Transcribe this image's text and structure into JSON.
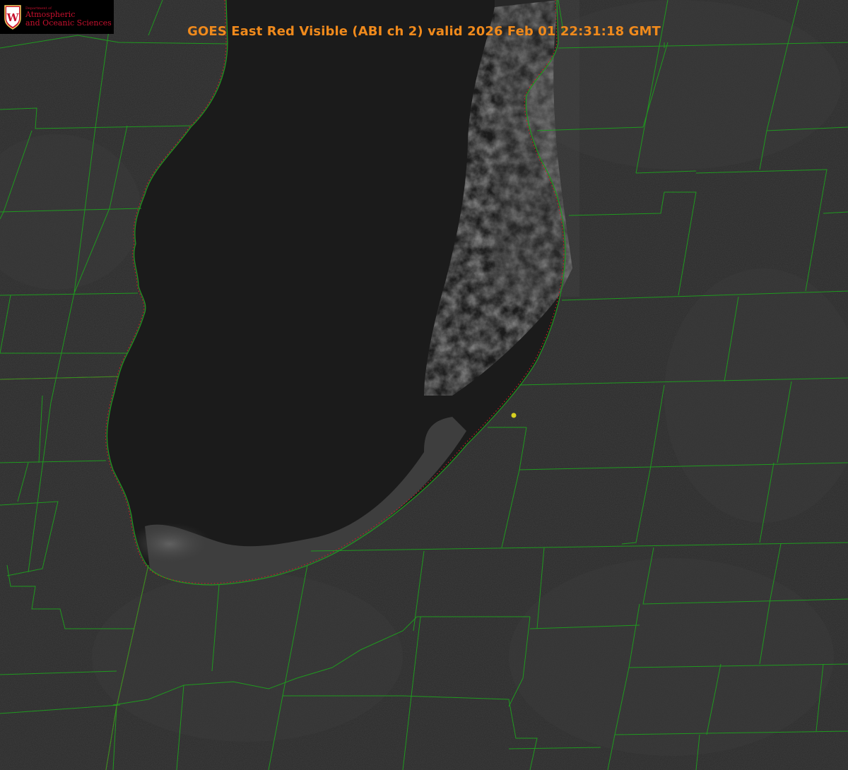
{
  "title": "GOES East Red Visible (ABI ch 2) valid 2026 Feb 01 22:31:18 GMT",
  "logo": {
    "department": "Department of",
    "line1": "Atmospheric",
    "line2": "and Oceanic Sciences",
    "crest_letter": "W"
  },
  "colors": {
    "land": "#2b2b2b",
    "lake": "#1a1a1a",
    "county_border": "#1f9a1f",
    "state_border": "#c08020",
    "shoreline_dots": "#d02020",
    "station_marker": "#d8d020",
    "title": "#f08a1c",
    "logo_text": "#c7102e"
  },
  "map": {
    "region": "Lake Michigan (southern basin)",
    "features": [
      "lake-effect-cloud-bands",
      "shore-ice",
      "county-lines",
      "state-lines"
    ],
    "marker": "station-point"
  }
}
